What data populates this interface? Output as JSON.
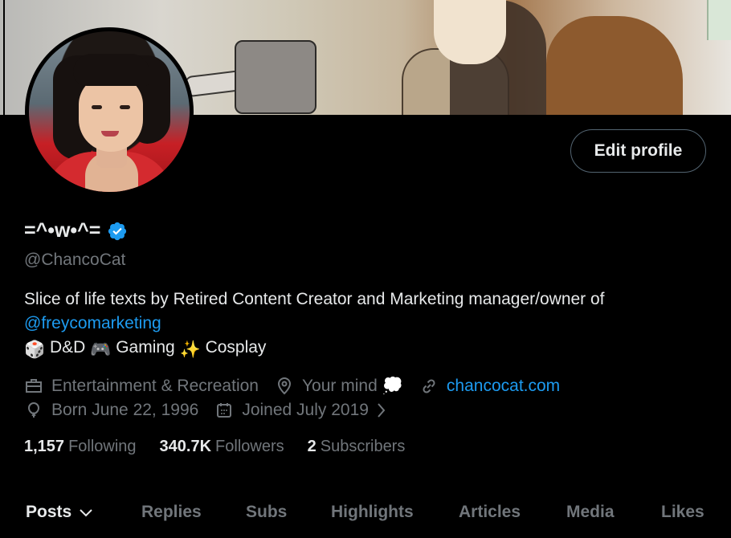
{
  "profile": {
    "display_name": "=^•w•^=",
    "handle": "@ChancoCat",
    "edit_profile_label": "Edit profile",
    "verified_icon": "verified-badge-icon"
  },
  "bio": {
    "line1": "Slice of life texts by Retired Content Creator and Marketing manager/owner of",
    "mention": "@freycomarketing",
    "line3_part1": "D&D",
    "line3_part2": "Gaming",
    "line3_part3": "Cosplay",
    "emoji1": "🎲",
    "emoji2": "🎮",
    "emoji3": "✨"
  },
  "meta": {
    "category": "Entertainment & Recreation",
    "location": "Your mind",
    "location_emoji": "💭",
    "website": "chancocat.com",
    "birthday": "Born June 22, 1996",
    "joined": "Joined July 2019"
  },
  "counts": {
    "following_value": "1,157",
    "following_label": "Following",
    "followers_value": "340.7K",
    "followers_label": "Followers",
    "subscribers_value": "2",
    "subscribers_label": "Subscribers"
  },
  "tabs": [
    {
      "label": "Posts"
    },
    {
      "label": "Replies"
    },
    {
      "label": "Subs"
    },
    {
      "label": "Highlights"
    },
    {
      "label": "Articles"
    },
    {
      "label": "Media"
    },
    {
      "label": "Likes"
    }
  ],
  "colors": {
    "background": "#000000",
    "text": "#e7e9ea",
    "muted": "#71767b",
    "accent": "#1d9bf0"
  }
}
